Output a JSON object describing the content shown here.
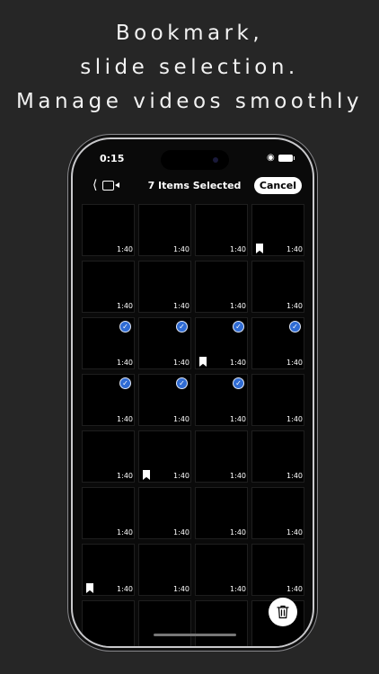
{
  "headline": [
    "Bookmark,",
    "slide selection.",
    "Manage videos smoothly"
  ],
  "status": {
    "time": "0:15"
  },
  "nav": {
    "back_icon": "chevron-left",
    "title": "7 Items Selected",
    "cancel_label": "Cancel"
  },
  "grid": {
    "cells": [
      {
        "duration": "1:40",
        "selected": false,
        "bookmarked": false
      },
      {
        "duration": "1:40",
        "selected": false,
        "bookmarked": false
      },
      {
        "duration": "1:40",
        "selected": false,
        "bookmarked": false
      },
      {
        "duration": "1:40",
        "selected": false,
        "bookmarked": true
      },
      {
        "duration": "1:40",
        "selected": false,
        "bookmarked": false
      },
      {
        "duration": "1:40",
        "selected": false,
        "bookmarked": false
      },
      {
        "duration": "1:40",
        "selected": false,
        "bookmarked": false
      },
      {
        "duration": "1:40",
        "selected": false,
        "bookmarked": false
      },
      {
        "duration": "1:40",
        "selected": true,
        "bookmarked": false
      },
      {
        "duration": "1:40",
        "selected": true,
        "bookmarked": false
      },
      {
        "duration": "1:40",
        "selected": true,
        "bookmarked": true
      },
      {
        "duration": "1:40",
        "selected": true,
        "bookmarked": false
      },
      {
        "duration": "1:40",
        "selected": true,
        "bookmarked": false
      },
      {
        "duration": "1:40",
        "selected": true,
        "bookmarked": false
      },
      {
        "duration": "1:40",
        "selected": true,
        "bookmarked": false
      },
      {
        "duration": "1:40",
        "selected": false,
        "bookmarked": false
      },
      {
        "duration": "1:40",
        "selected": false,
        "bookmarked": false
      },
      {
        "duration": "1:40",
        "selected": false,
        "bookmarked": true
      },
      {
        "duration": "1:40",
        "selected": false,
        "bookmarked": false
      },
      {
        "duration": "1:40",
        "selected": false,
        "bookmarked": false
      },
      {
        "duration": "1:40",
        "selected": false,
        "bookmarked": false
      },
      {
        "duration": "1:40",
        "selected": false,
        "bookmarked": false
      },
      {
        "duration": "1:40",
        "selected": false,
        "bookmarked": false
      },
      {
        "duration": "1:40",
        "selected": false,
        "bookmarked": false
      },
      {
        "duration": "1:40",
        "selected": false,
        "bookmarked": true
      },
      {
        "duration": "1:40",
        "selected": false,
        "bookmarked": false
      },
      {
        "duration": "1:40",
        "selected": false,
        "bookmarked": false
      },
      {
        "duration": "1:40",
        "selected": false,
        "bookmarked": false
      },
      {
        "duration": "",
        "selected": false,
        "bookmarked": false
      },
      {
        "duration": "",
        "selected": false,
        "bookmarked": false
      },
      {
        "duration": "",
        "selected": false,
        "bookmarked": false
      },
      {
        "duration": "",
        "selected": false,
        "bookmarked": false
      }
    ]
  },
  "colors": {
    "background": "#262626",
    "accent": "#2f6bd3",
    "screen": "#0a0a0a"
  },
  "icons": {
    "trash": "trash-icon",
    "bookmark": "bookmark-icon",
    "check": "checkmark-icon"
  }
}
